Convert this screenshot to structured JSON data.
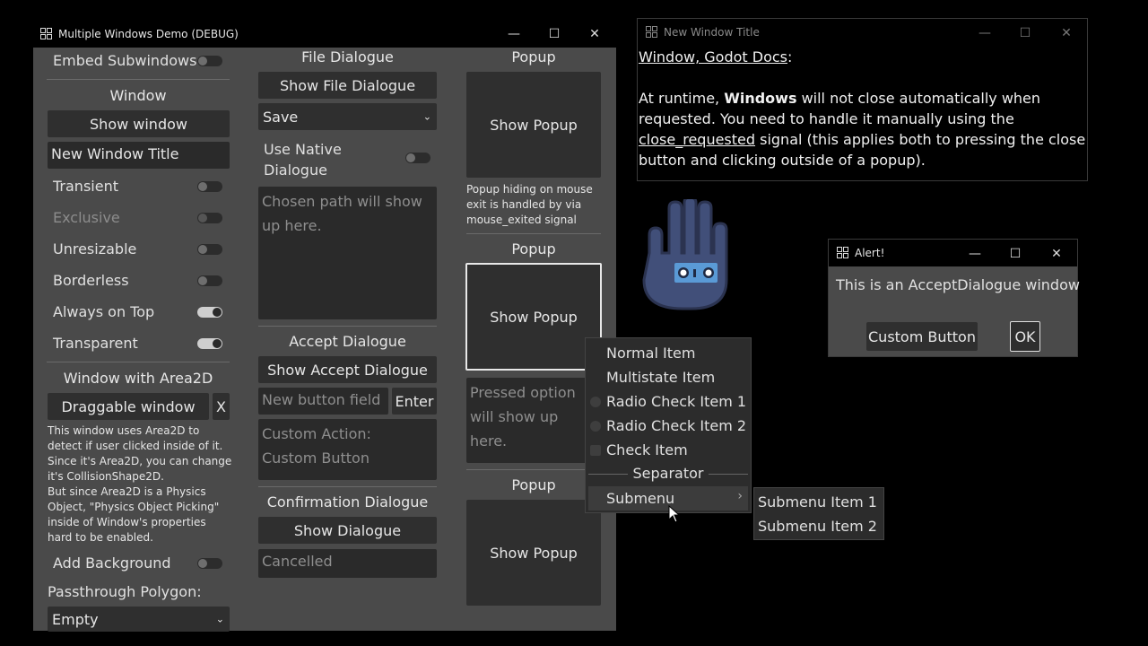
{
  "main_window": {
    "title": "Multiple Windows Demo (DEBUG)",
    "left_col": {
      "embed_subwindows": "Embed Subwindows",
      "window_heading": "Window",
      "show_window": "Show window",
      "title_field_value": "New Window Title",
      "transient": "Transient",
      "exclusive": "Exclusive",
      "unresizable": "Unresizable",
      "borderless": "Borderless",
      "always_on_top": "Always on Top",
      "transparent": "Transparent",
      "area2d_heading": "Window with Area2D",
      "draggable_window": "Draggable window",
      "close_x": "X",
      "area2d_desc_1": "This window uses Area2D to",
      "area2d_desc_2": "detect if user clicked inside of it.",
      "area2d_desc_3": "Since it's Area2D, you can change",
      "area2d_desc_4": "it's CollisionShape2D.",
      "area2d_desc_5": "But since Area2D is a Physics",
      "area2d_desc_6": "Object, \"Physics Object Picking\"",
      "area2d_desc_7": "inside of Window's properties",
      "area2d_desc_8": "hard to be enabled.",
      "add_background": "Add Background",
      "passthrough_label": "Passthrough Polygon:",
      "passthrough_value": "Empty"
    },
    "mid_col": {
      "file_heading": "File Dialogue",
      "show_file": "Show File Dialogue",
      "mode_value": "Save",
      "native_1": "Use Native",
      "native_2": "Dialogue",
      "chosen_path_1": "Chosen path will show",
      "chosen_path_2": "up here.",
      "accept_heading": "Accept Dialogue",
      "show_accept": "Show Accept Dialogue",
      "new_button_placeholder": "New button field",
      "enter": "Enter",
      "custom_action_1": "Custom Action:",
      "custom_action_2": "Custom Button",
      "confirm_heading": "Confirmation Dialogue",
      "show_dialogue": "Show Dialogue",
      "cancelled": "Cancelled"
    },
    "right_col": {
      "popup_heading_1": "Popup",
      "show_popup_1": "Show Popup",
      "popup_note_1": "Popup hiding on mouse",
      "popup_note_2": "exit is handled by via",
      "popup_note_3": "mouse_exited signal",
      "popup_heading_2": "Popup",
      "show_popup_2": "Show Popup",
      "pressed_1": "Pressed option",
      "pressed_2": "will show up",
      "pressed_3": "here.",
      "popup_heading_3": "Popup",
      "show_popup_3": "Show Popup"
    }
  },
  "new_window": {
    "title": "New Window Title",
    "link": "Window, Godot Docs",
    "colon": ":",
    "text_1a": "At runtime, ",
    "text_1b": "Windows",
    "text_1c": " will not close automatically when",
    "text_2": "requested. You need to handle it manually using the",
    "text_3a": "close_requested",
    "text_3b": " signal (this applies both to pressing the close",
    "text_4": "button and clicking outside of a popup)."
  },
  "alert": {
    "title": "Alert!",
    "message": "This is an AcceptDialogue window",
    "custom_button": "Custom Button",
    "ok": "OK"
  },
  "popup_menu": {
    "items": [
      "Normal Item",
      "Multistate Item",
      "Radio Check Item 1",
      "Radio Check Item 2",
      "Check Item"
    ],
    "separator": "Separator",
    "submenu": "Submenu",
    "submenu_arrow": "›",
    "sub_items": [
      "Submenu Item 1",
      "Submenu Item 2"
    ]
  },
  "window_controls": {
    "minimize": "—",
    "maximize": "☐",
    "close": "✕"
  }
}
